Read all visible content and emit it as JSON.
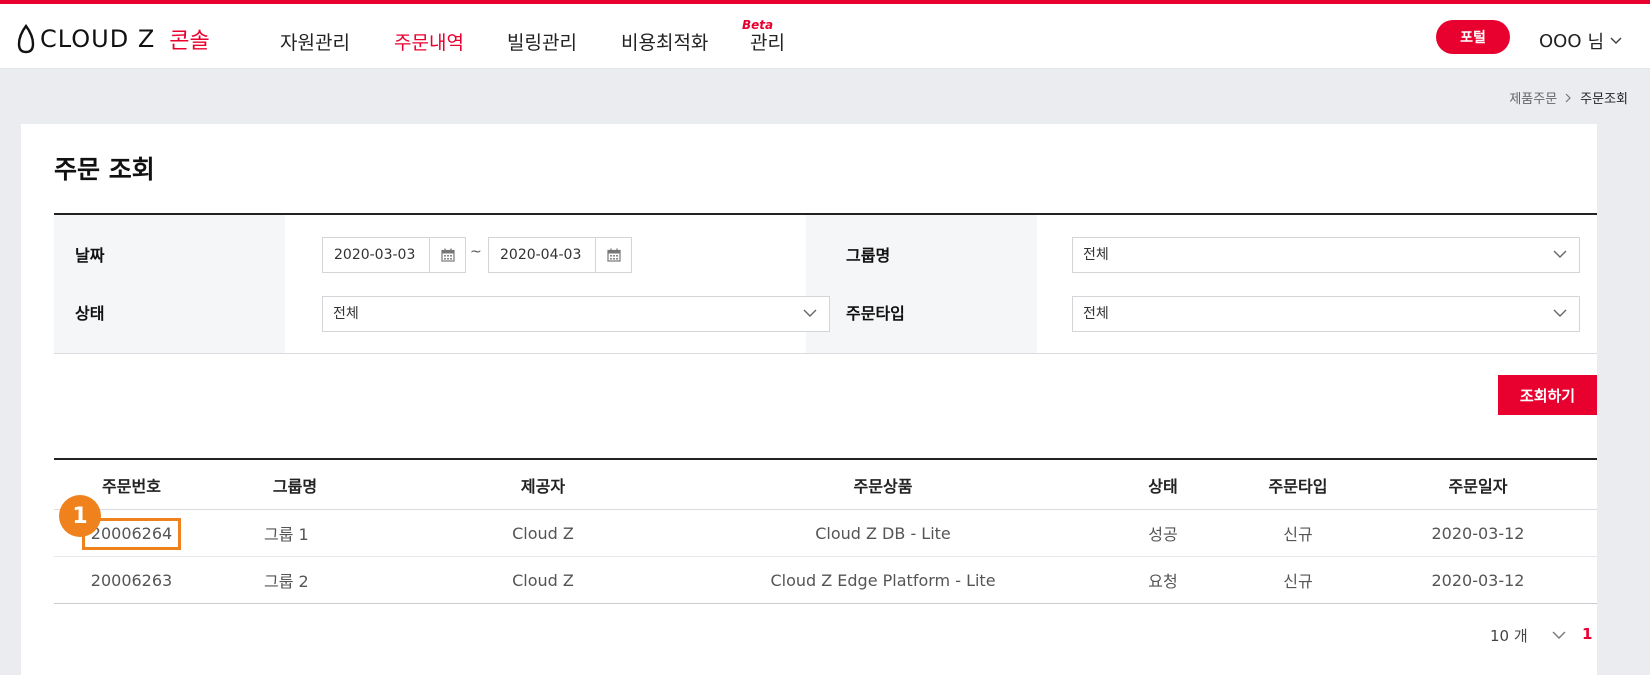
{
  "header": {
    "logo_text": "CLOUD Z",
    "logo_console": "콘솔",
    "nav": [
      {
        "label": "자원관리",
        "active": false
      },
      {
        "label": "주문내역",
        "active": true
      },
      {
        "label": "빌링관리",
        "active": false
      },
      {
        "label": "비용최적화",
        "active": false
      },
      {
        "label": "관리",
        "active": false
      }
    ],
    "beta_label": "Beta",
    "portal_button": "포털",
    "user_name": "OOO",
    "user_suffix": "님",
    "accent_color": "#e8002f"
  },
  "breadcrumb": [
    "제품주문",
    "주문조회"
  ],
  "page_title": "주문 조회",
  "filters": {
    "date_label": "날짜",
    "date_from": "2020-03-03",
    "date_tilde": "~",
    "date_to": "2020-04-03",
    "group_label": "그룹명",
    "group_value": "전체",
    "status_label": "상태",
    "status_value": "전체",
    "order_type_label": "주문타입",
    "order_type_value": "전체"
  },
  "search_button": "조회하기",
  "table": {
    "columns": [
      "주문번호",
      "그룹명",
      "제공자",
      "주문상품",
      "상태",
      "주문타입",
      "주문일자"
    ],
    "rows": [
      {
        "order_no": "20006264",
        "group": "그룹 1",
        "provider": "Cloud Z",
        "product": "Cloud Z DB - Lite",
        "status": "성공",
        "type": "신규",
        "date": "2020-03-12"
      },
      {
        "order_no": "20006263",
        "group": "그룹 2",
        "provider": "Cloud Z",
        "product": "Cloud Z Edge Platform - Lite",
        "status": "요청",
        "type": "신규",
        "date": "2020-03-12"
      }
    ]
  },
  "pagination": {
    "page_size": "10 개",
    "current_page": "1"
  },
  "annotation": {
    "marker_number": "1",
    "marker_color": "#f0821e"
  }
}
